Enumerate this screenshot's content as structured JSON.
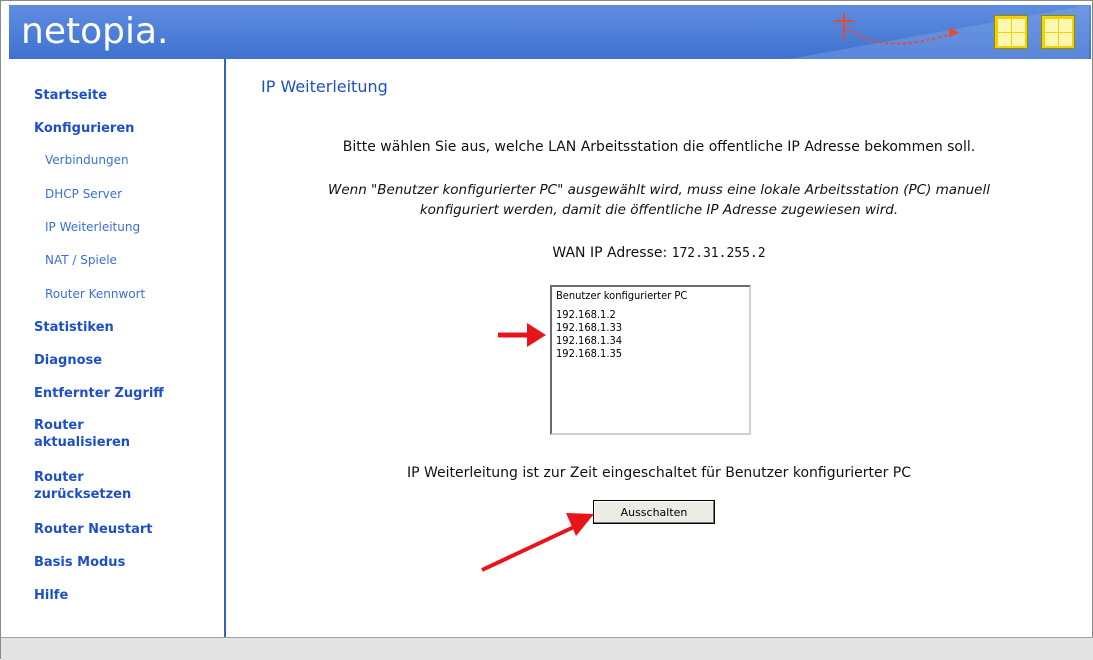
{
  "header": {
    "brand_text": "netopia",
    "brand_dot": ".",
    "brand_color": "#3f71cf",
    "accent_yellow": "#f2d300"
  },
  "sidebar": {
    "items": [
      {
        "label": "Startseite"
      },
      {
        "label": "Konfigurieren"
      },
      {
        "label": "Verbindungen"
      },
      {
        "label": "DHCP Server"
      },
      {
        "label": "IP Weiterleitung"
      },
      {
        "label": "NAT / Spiele"
      },
      {
        "label": "Router Kennwort"
      },
      {
        "label": "Statistiken"
      },
      {
        "label": "Diagnose"
      },
      {
        "label": "Entfernter Zugriff"
      },
      {
        "label_line1": "Router",
        "label_line2": "aktualisieren"
      },
      {
        "label_line1": "Router",
        "label_line2": "zurücksetzen"
      },
      {
        "label": "Router Neustart"
      },
      {
        "label": "Basis Modus"
      },
      {
        "label": "Hilfe"
      }
    ]
  },
  "main": {
    "title": "IP Weiterleitung",
    "intro": "Bitte wählen Sie aus, welche LAN Arbeitsstation die offentliche IP Adresse bekommen soll.",
    "note_line1": "Wenn \"Benutzer konfigurierter PC\" ausgewählt wird, muss eine lokale Arbeitsstation (PC) manuell",
    "note_line2": "konfiguriert werden, damit die öffentliche IP Adresse zugewiesen wird.",
    "wan_label": "WAN IP Adresse:",
    "wan_ip": "172.31.255.2",
    "pc_list": {
      "options": [
        "Benutzer konfigurierter PC",
        "192.168.1.2",
        "192.168.1.33",
        "192.168.1.34",
        "192.168.1.35"
      ]
    },
    "status": "IP Weiterleitung ist zur Zeit eingeschaltet für Benutzer konfigurierter PC",
    "off_button_label": "Ausschalten"
  },
  "annotations": {
    "arrow_color": "#e8141b"
  }
}
